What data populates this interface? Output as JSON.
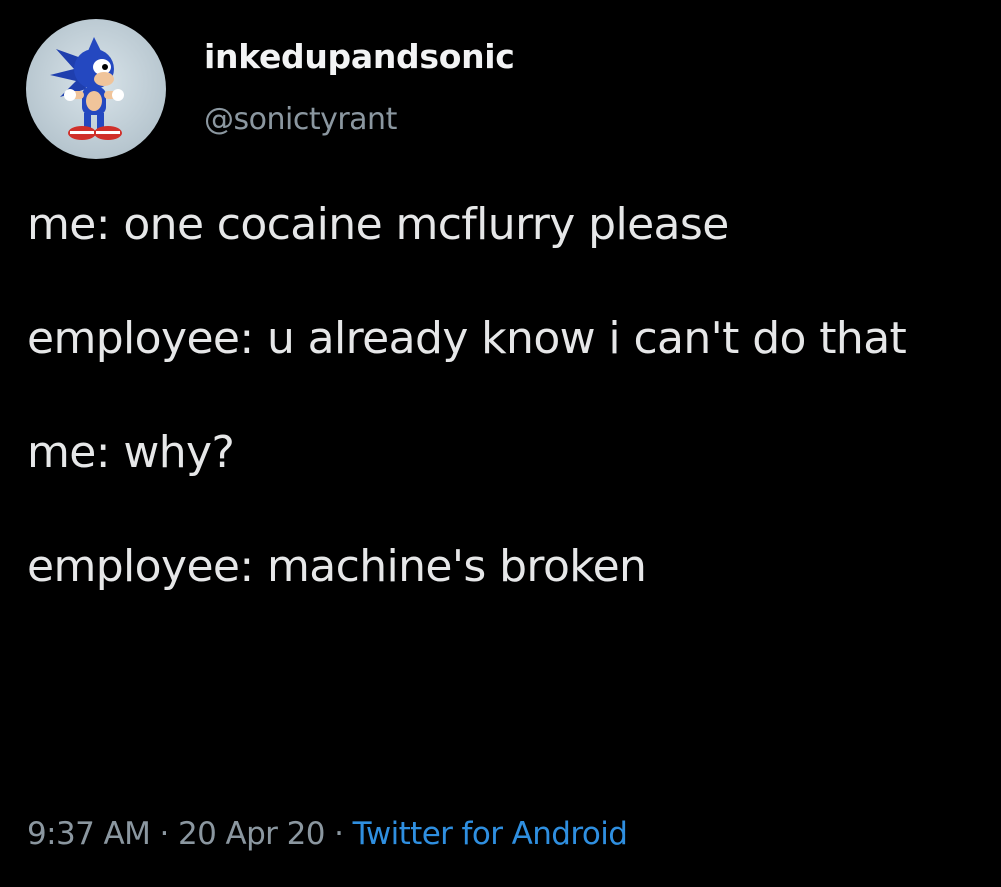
{
  "user": {
    "display_name": "inkedupandsonic",
    "handle": "@sonictyrant"
  },
  "tweet": {
    "line1": "me: one cocaine mcflurry please",
    "line2": "employee: u already know i can't do that",
    "line3": "me: why?",
    "line4": "employee: machine's broken"
  },
  "meta": {
    "time": "9:37 AM",
    "separator": " · ",
    "date": "20 Apr 20",
    "source": "Twitter for Android"
  }
}
